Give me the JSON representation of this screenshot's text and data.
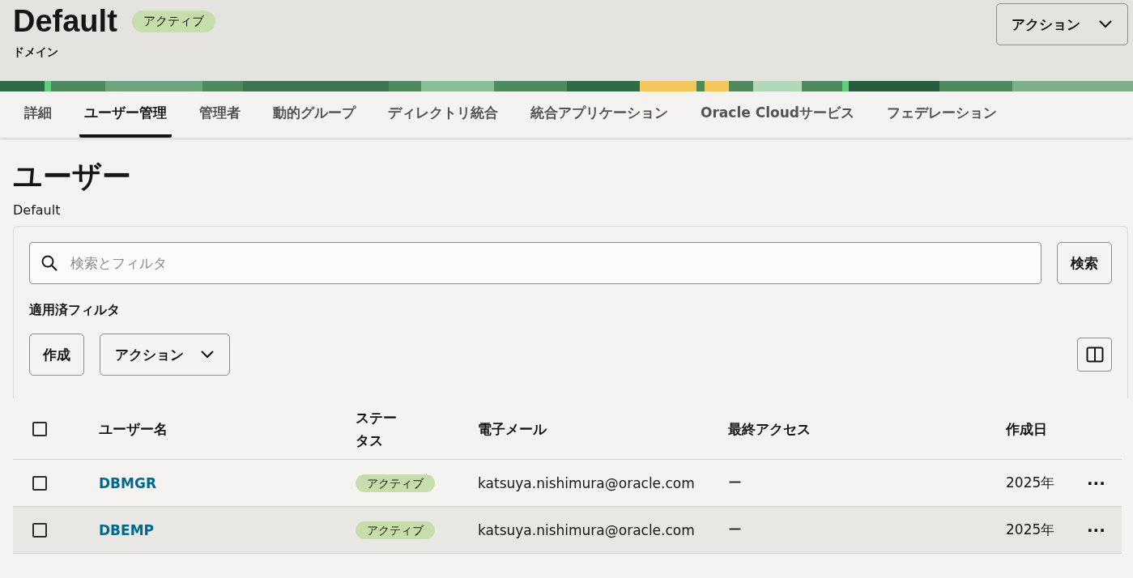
{
  "header": {
    "title": "Default",
    "status": "アクティブ",
    "subtitle": "ドメイン",
    "action_button": "アクション"
  },
  "tabs": [
    {
      "label": "詳細",
      "selected": false
    },
    {
      "label": "ユーザー管理",
      "selected": true
    },
    {
      "label": "管理者",
      "selected": false
    },
    {
      "label": "動的グループ",
      "selected": false
    },
    {
      "label": "ディレクトリ統合",
      "selected": false
    },
    {
      "label": "統合アプリケーション",
      "selected": false
    },
    {
      "label": "Oracle Cloudサービス",
      "selected": false
    },
    {
      "label": "フェデレーション",
      "selected": false
    }
  ],
  "section": {
    "title": "ユーザー",
    "subtitle": "Default"
  },
  "search": {
    "placeholder": "検索とフィルタ",
    "button": "検索"
  },
  "applied_filters": "適用済フィルタ",
  "toolbar": {
    "create": "作成",
    "actions": "アクション"
  },
  "table": {
    "select_all_checked": false,
    "columns": [
      "ユーザー名",
      "ステータス",
      "電子メール",
      "最終アクセス",
      "作成日"
    ],
    "rows": [
      {
        "checked": false,
        "highlighted": false,
        "name": "DBMGR",
        "status": "アクティブ",
        "email": "katsuya.nishimura@oracle.com",
        "last_access": "ー",
        "created": "2025年",
        "menu": "···"
      },
      {
        "checked": false,
        "highlighted": true,
        "name": "DBEMP",
        "status": "アクティブ",
        "email": "katsuya.nishimura@oracle.com",
        "last_access": "ー",
        "created": "2025年",
        "menu": "···"
      }
    ]
  }
}
